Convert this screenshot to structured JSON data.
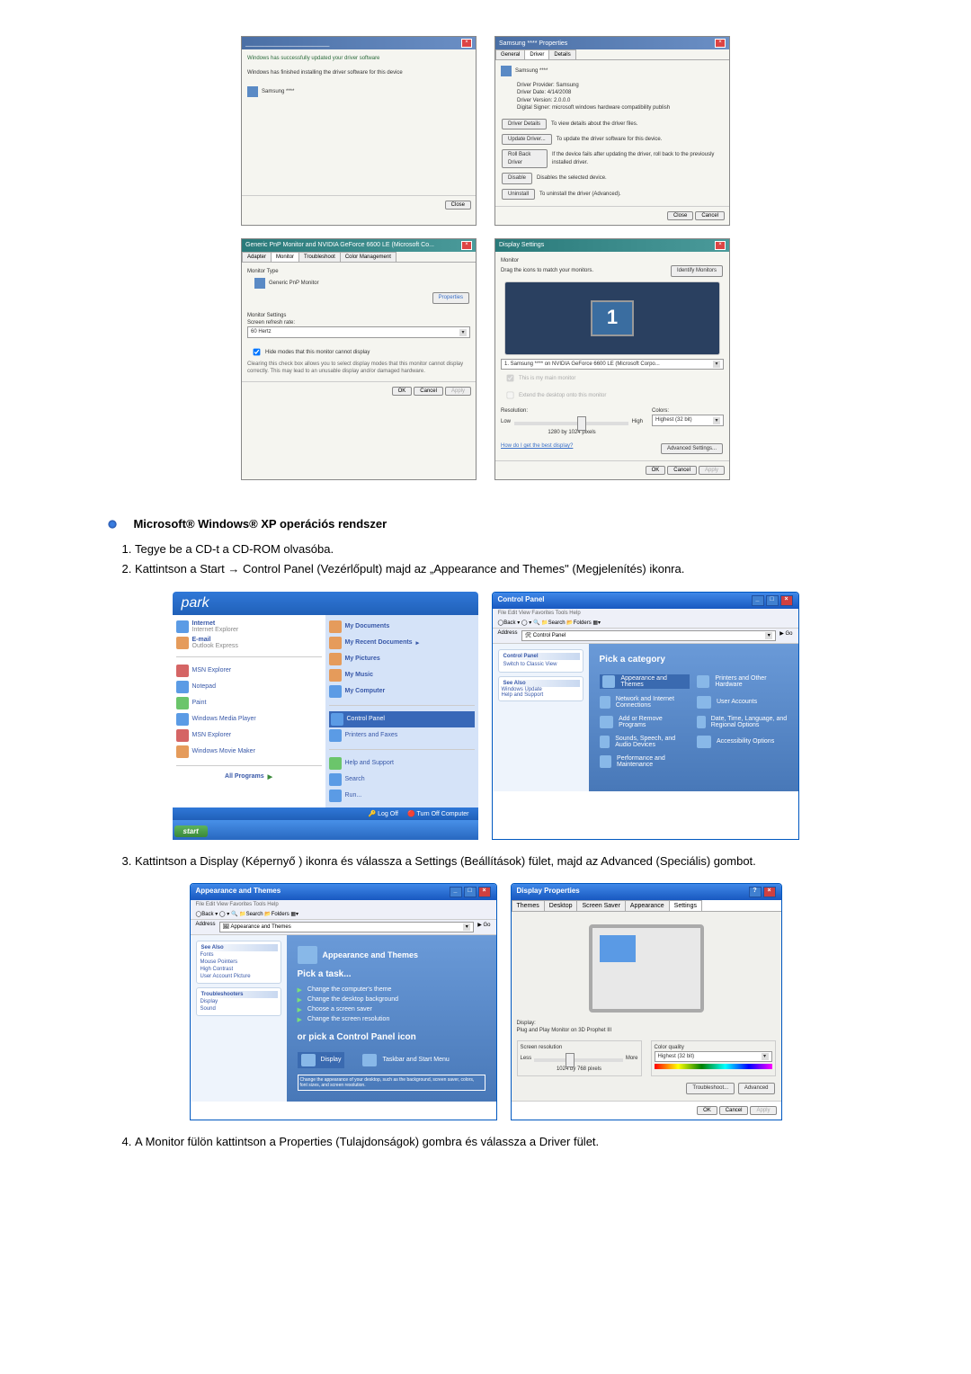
{
  "topLeft1": {
    "title": "________________________",
    "body1": "Windows has successfully updated your driver software",
    "body2": "Windows has finished installing the driver software for this device",
    "device": "Samsung ****",
    "closeBtn": "Close"
  },
  "topRight1": {
    "title": "Samsung **** Properties",
    "tabs": [
      "General",
      "Driver",
      "Details"
    ],
    "deviceName": "Samsung ****",
    "providerLabel": "Driver Provider:",
    "providerValue": "Samsung",
    "dateLabel": "Driver Date:",
    "dateValue": "4/14/2008",
    "versionLabel": "Driver Version:",
    "versionValue": "2.0.0.0",
    "signerLabel": "Digital Signer:",
    "signerValue": "microsoft windows hardware compatibility publish",
    "btn1": "Driver Details",
    "desc1": "To view details about the driver files.",
    "btn2": "Update Driver...",
    "desc2": "To update the driver software for this device.",
    "btn3": "Roll Back Driver",
    "desc3": "If the device fails after updating the driver, roll back to the previously installed driver.",
    "btn4": "Disable",
    "desc4": "Disables the selected device.",
    "btn5": "Uninstall",
    "desc5": "To uninstall the driver (Advanced).",
    "okBtn": "Close",
    "cancelBtn": "Cancel"
  },
  "topLeft2": {
    "title": "Generic PnP Monitor and NVIDIA GeForce 6600 LE (Microsoft Co...",
    "tabs": [
      "Adapter",
      "Monitor",
      "Troubleshoot",
      "Color Management"
    ],
    "typeLabel": "Monitor Type",
    "typeValue": "Generic PnP Monitor",
    "propBtn": "Properties",
    "settingsLabel": "Monitor Settings",
    "refreshLabel": "Screen refresh rate:",
    "refreshValue": "60 Hertz",
    "hideLabel": "Hide modes that this monitor cannot display",
    "hideDesc": "Clearing this check box allows you to select display modes that this monitor cannot display correctly. This may lead to an unusable display and/or damaged hardware.",
    "okBtn": "OK",
    "cancelBtn": "Cancel",
    "applyBtn": "Apply"
  },
  "topRight2": {
    "title": "Display Settings",
    "monitorLabel": "Monitor",
    "dragLabel": "Drag the icons to match your monitors.",
    "identifyBtn": "Identify Monitors",
    "monitorNum": "1",
    "deviceDropdown": "1. Samsung **** on NVIDIA GeForce 6600 LE (Microsoft Corpo...",
    "check1": "This is my main monitor",
    "check2": "Extend the desktop onto this monitor",
    "resLabel": "Resolution:",
    "lowLabel": "Low",
    "highLabel": "High",
    "resValue": "1280 by 1024 pixels",
    "colorLabel": "Colors:",
    "colorValue": "Highest (32 bit)",
    "helpLink": "How do I get the best display?",
    "advBtn": "Advanced Settings...",
    "okBtn": "OK",
    "cancelBtn": "Cancel",
    "applyBtn": "Apply"
  },
  "sectionHeading": "Microsoft® Windows® XP operációs rendszer",
  "step1": "Tegye be a CD-t a CD-ROM olvasóba.",
  "step2": "Kattintson a Start → Control Panel (Vezérlőpult) majd az „Appearance and Themes\" (Megjelenítés) ikonra.",
  "step3": "Kattintson a Display (Képernyő ) ikonra és válassza a Settings (Beállítások) fület, majd az Advanced (Speciális) gombot.",
  "step4": "A Monitor fülön kattintson a Properties (Tulajdonságok) gombra és válassza a Driver fület.",
  "xpStart": {
    "header": "park",
    "left": {
      "internet": "Internet",
      "internetSub": "Internet Explorer",
      "email": "E-mail",
      "emailSub": "Outlook Express",
      "item1": "MSN Explorer",
      "item2": "Windows Media Player",
      "item3": "Windows Movie Maker",
      "allPrograms": "All Programs"
    },
    "right": {
      "item1": "My Documents",
      "item2": "My Recent Documents",
      "item3": "My Pictures",
      "item4": "My Music",
      "item5": "My Computer",
      "item6": "Control Panel",
      "item7": "Printers and Faxes",
      "item8": "Help and Support",
      "item9": "Search",
      "item10": "Run..."
    },
    "logOff": "Log Off",
    "turnOff": "Turn Off Computer",
    "startBtn": "start",
    "item_paint": "Paint",
    "item_wmp": "Windows Media Player",
    "item_notepad": "Notepad",
    "item_msn": "MSN Explorer"
  },
  "xpControlPanel": {
    "title": "Control Panel",
    "pickCategory": "Pick a category",
    "cat1": "Appearance and Themes",
    "cat2": "Printers and Other Hardware",
    "cat3": "Network and Internet Connections",
    "cat4": "User Accounts",
    "cat5": "Add or Remove Programs",
    "cat6": "Date, Time, Language, and Regional Options",
    "cat7": "Sounds, Speech, and Audio Devices",
    "cat8": "Accessibility Options",
    "cat9": "Performance and Maintenance",
    "sidebar1": "Control Panel",
    "sidebarSwitch": "Switch to Classic View",
    "sidebarSeeAlso": "See Also",
    "sidebarWU": "Windows Update",
    "sidebarHelp": "Help and Support"
  },
  "xpAppearance": {
    "title": "Appearance and Themes",
    "pickTask": "Pick a task...",
    "task1": "Change the computer's theme",
    "task2": "Change the desktop background",
    "task3": "Choose a screen saver",
    "task4": "Change the screen resolution",
    "orPick": "or pick a Control Panel icon",
    "icon1": "Display",
    "icon2": "Taskbar and Start Menu",
    "sidebarSeeAlso": "See Also",
    "sidebarTS": "Troubleshooters"
  },
  "xpDisplayProps": {
    "title": "Display Properties",
    "tabs": [
      "Themes",
      "Desktop",
      "Screen Saver",
      "Appearance",
      "Settings"
    ],
    "displayLabel": "Display:",
    "displayValue": "Plug and Play Monitor on 3D Prophet III",
    "screenResLabel": "Screen resolution",
    "lessLabel": "Less",
    "moreLabel": "More",
    "resValue": "1024 by 768 pixels",
    "colorQualityLabel": "Color quality",
    "colorValue": "Highest (32 bit)",
    "troubleshootBtn": "Troubleshoot...",
    "advancedBtn": "Advanced",
    "okBtn": "OK",
    "cancelBtn": "Cancel",
    "applyBtn": "Apply"
  }
}
